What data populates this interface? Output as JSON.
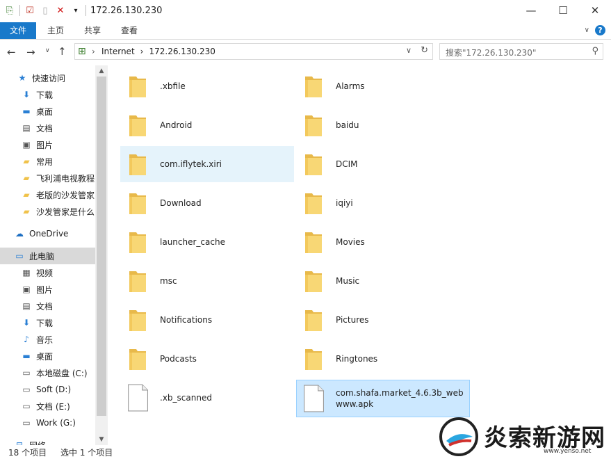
{
  "window": {
    "title": "172.26.130.230",
    "minimize": "—",
    "maximize": "☐",
    "close": "✕"
  },
  "ribbon": {
    "tabs": [
      "文件",
      "主页",
      "共享",
      "查看"
    ],
    "expand": "∨",
    "help": "?"
  },
  "address": {
    "crumbs": [
      "Internet",
      "›",
      "172.26.130.230"
    ],
    "lead": "›",
    "dropdown": "∨",
    "refresh": "↻"
  },
  "search": {
    "placeholder": "搜索\"172.26.130.230\""
  },
  "nav": {
    "quick_access": "快速访问",
    "items": [
      {
        "label": "下载",
        "icon": "download-icon",
        "pinned": true
      },
      {
        "label": "桌面",
        "icon": "desktop-icon",
        "pinned": true
      },
      {
        "label": "文档",
        "icon": "document-icon",
        "pinned": true
      },
      {
        "label": "图片",
        "icon": "picture-icon",
        "pinned": true
      },
      {
        "label": "常用",
        "icon": "folder-icon",
        "pinned": false
      },
      {
        "label": "飞利浦电视教程-",
        "icon": "folder-icon",
        "pinned": false
      },
      {
        "label": "老版的沙发管家:",
        "icon": "folder-icon",
        "pinned": false
      },
      {
        "label": "沙发管家是什么",
        "icon": "folder-icon",
        "pinned": false
      }
    ],
    "onedrive": "OneDrive",
    "this_pc": "此电脑",
    "pc_items": [
      {
        "label": "视频",
        "icon": "video-icon"
      },
      {
        "label": "图片",
        "icon": "picture-icon"
      },
      {
        "label": "文档",
        "icon": "document-icon"
      },
      {
        "label": "下载",
        "icon": "download-icon"
      },
      {
        "label": "音乐",
        "icon": "music-icon"
      },
      {
        "label": "桌面",
        "icon": "desktop-icon"
      },
      {
        "label": "本地磁盘 (C:)",
        "icon": "drive-icon"
      },
      {
        "label": "Soft (D:)",
        "icon": "drive-icon"
      },
      {
        "label": "文档 (E:)",
        "icon": "drive-icon"
      },
      {
        "label": "Work (G:)",
        "icon": "drive-icon"
      }
    ],
    "network": "网络"
  },
  "files": [
    {
      "name": ".xbfile",
      "type": "folder"
    },
    {
      "name": "Alarms",
      "type": "folder"
    },
    {
      "name": "Android",
      "type": "folder"
    },
    {
      "name": "baidu",
      "type": "folder"
    },
    {
      "name": "com.iflytek.xiri",
      "type": "folder",
      "state": "hover"
    },
    {
      "name": "DCIM",
      "type": "folder"
    },
    {
      "name": "Download",
      "type": "folder"
    },
    {
      "name": "iqiyi",
      "type": "folder"
    },
    {
      "name": "launcher_cache",
      "type": "folder"
    },
    {
      "name": "Movies",
      "type": "folder"
    },
    {
      "name": "msc",
      "type": "folder"
    },
    {
      "name": "Music",
      "type": "folder"
    },
    {
      "name": "Notifications",
      "type": "folder"
    },
    {
      "name": "Pictures",
      "type": "folder"
    },
    {
      "name": "Podcasts",
      "type": "folder"
    },
    {
      "name": "Ringtones",
      "type": "folder"
    },
    {
      "name": ".xb_scanned",
      "type": "file"
    },
    {
      "name": "com.shafa.market_4.6.3b_webwww.apk",
      "type": "file",
      "state": "selected"
    }
  ],
  "status": {
    "count": "18 个项目",
    "selected": "选中 1 个项目"
  },
  "watermark": {
    "text": "炎索新游网",
    "url": "www.yenso.net"
  },
  "colors": {
    "accent": "#1979ca",
    "folder": "#f8d775",
    "selected_bg": "#cce8ff",
    "hover_bg": "#e5f3fb"
  }
}
